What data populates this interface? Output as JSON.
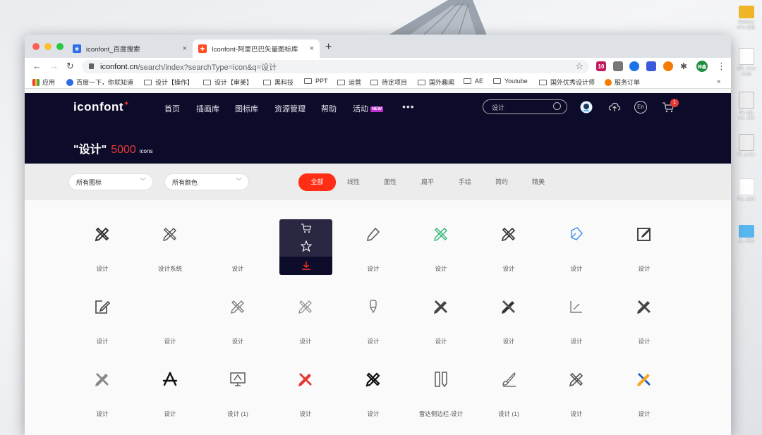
{
  "desktop": {
    "items": [
      {
        "label": "Matthew",
        "sub": "97% 使用"
      },
      {
        "label": "1和...docx",
        "sub": "4 MB"
      },
      {
        "label": "5a...jpg",
        "sub": "2,3...362"
      },
      {
        "label": "分...y.doc",
        "sub": ""
      },
      {
        "label": "Po...adUI",
        "sub": ""
      },
      {
        "label": "未...件夹",
        "sub": ""
      }
    ]
  },
  "browser": {
    "tabs": [
      {
        "title": "iconfont_百度搜索",
        "active": false
      },
      {
        "title": "Iconfont-阿里巴巴矢量图标库",
        "active": true
      }
    ],
    "new_tab": "+",
    "close_glyph": "×",
    "url_host": "iconfont.cn",
    "url_path": "/search/index?searchType=icon&q=设计",
    "star_glyph": "☆",
    "profile_label": "梓鑫",
    "more_glyph": "⋮",
    "ext_badge": "10",
    "bookmarks": [
      {
        "label": "应用",
        "icon": "apps-icon"
      },
      {
        "label": "百度一下，你就知道",
        "icon": "baidu-icon"
      },
      {
        "label": "设计【操作】",
        "icon": "folder-icon"
      },
      {
        "label": "设计【审美】",
        "icon": "folder-icon"
      },
      {
        "label": "黑科技",
        "icon": "folder-icon"
      },
      {
        "label": "PPT",
        "icon": "folder-icon"
      },
      {
        "label": "运营",
        "icon": "folder-icon"
      },
      {
        "label": "待定项目",
        "icon": "folder-icon"
      },
      {
        "label": "国外趣闻",
        "icon": "folder-icon"
      },
      {
        "label": "AE",
        "icon": "folder-icon"
      },
      {
        "label": "Youtube",
        "icon": "folder-icon"
      },
      {
        "label": "国外优秀设计师",
        "icon": "folder-icon"
      },
      {
        "label": "服务订单",
        "icon": "order-icon"
      }
    ],
    "bookmarks_more": "»"
  },
  "site": {
    "logo": "iconfont",
    "logo_mark": "✦",
    "nav": [
      "首页",
      "插画库",
      "图标库",
      "资源管理",
      "帮助",
      "活动"
    ],
    "new_badge": "NEW",
    "nav_more": "•••",
    "search_placeholder": "设计",
    "lang_label": "En",
    "cart_count": "1",
    "result_query": "\"设计\"",
    "result_count": "5000",
    "result_unit": "icons",
    "accent": "#ff2e14",
    "header_bg": "#0d0b2a"
  },
  "filters": {
    "icon_select": "所有图标",
    "color_select": "所有颜色",
    "styles": [
      "全部",
      "线性",
      "面性",
      "扁平",
      "手绘",
      "简约",
      "精美"
    ],
    "active_style": "全部"
  },
  "grid": {
    "rows": [
      [
        "设计",
        "设计系统",
        "设计",
        "",
        "设计",
        "设计",
        "设计",
        "设计",
        "设计"
      ],
      [
        "设计",
        "设计",
        "设计",
        "设计",
        "设计",
        "设计",
        "设计",
        "设计",
        "设计"
      ],
      [
        "设计",
        "设计",
        "设计 (1)",
        "设计",
        "设计",
        "雷达侧边栏-设计",
        "设计 (1)",
        "设计",
        "设计"
      ]
    ]
  }
}
